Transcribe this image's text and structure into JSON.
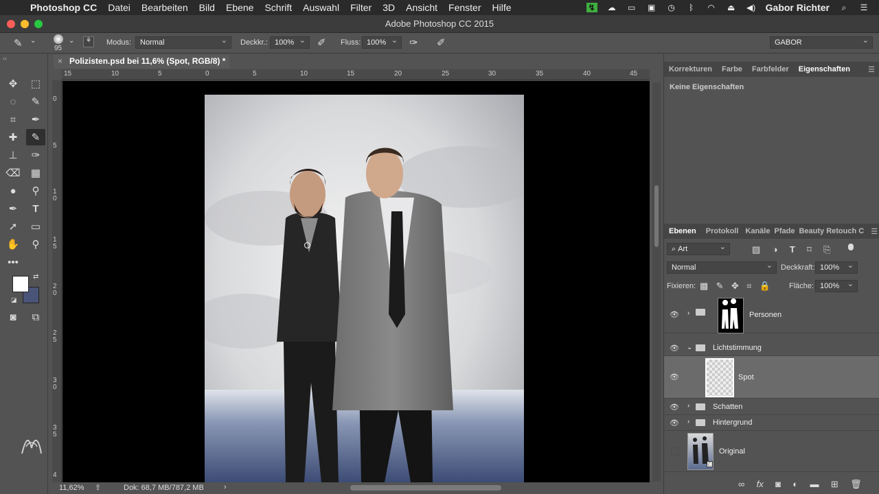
{
  "menubar": {
    "apple": "",
    "app": "Photoshop CC",
    "items": [
      "Datei",
      "Bearbeiten",
      "Bild",
      "Ebene",
      "Schrift",
      "Auswahl",
      "Filter",
      "3D",
      "Ansicht",
      "Fenster",
      "Hilfe"
    ],
    "user": "Gabor Richter"
  },
  "window": {
    "title": "Adobe Photoshop CC 2015"
  },
  "options": {
    "brush_size": "95",
    "mode_label": "Modus:",
    "mode_value": "Normal",
    "opacity_label": "Deckkr.:",
    "opacity_value": "100%",
    "flow_label": "Fluss:",
    "flow_value": "100%",
    "workspace": "GABOR"
  },
  "document": {
    "tab": "Polizisten.psd bei 11,6% (Spot, RGB/8) *",
    "close": "×"
  },
  "ruler": {
    "h_ticks": [
      "15",
      "10",
      "5",
      "0",
      "5",
      "10",
      "15",
      "20",
      "25",
      "30",
      "35",
      "40",
      "45"
    ],
    "v_ticks": [
      "0",
      "5",
      "1 0",
      "1 5",
      "2 0",
      "2 5",
      "3 0",
      "3 5",
      "4"
    ]
  },
  "status": {
    "zoom": "11,62%",
    "doc": "Dok: 68,7 MB/787,2 MB"
  },
  "properties_panel": {
    "tabs": [
      "Korrekturen",
      "Farbe",
      "Farbfelder",
      "Eigenschaften"
    ],
    "active_tab": "Eigenschaften",
    "empty_text": "Keine Eigenschaften"
  },
  "layers_panel": {
    "tabs": [
      "Ebenen",
      "Protokoll",
      "Kanäle",
      "Pfade",
      "Beauty Retouch C"
    ],
    "active_tab": "Ebenen",
    "filter_label": "Art",
    "blend_mode": "Normal",
    "opacity_label": "Deckkraft:",
    "opacity_value": "100%",
    "lock_label": "Fixieren:",
    "fill_label": "Fläche:",
    "fill_value": "100%",
    "layers": [
      {
        "name": "Personen",
        "type": "group-with-mask",
        "visible": true
      },
      {
        "name": "Lichtstimmung",
        "type": "group-open",
        "visible": true
      },
      {
        "name": "Spot",
        "type": "layer",
        "visible": true,
        "selected": true
      },
      {
        "name": "Schatten",
        "type": "group",
        "visible": true
      },
      {
        "name": "Hintergrund",
        "type": "group",
        "visible": true
      },
      {
        "name": "Original",
        "type": "smart-object",
        "visible": false
      }
    ]
  },
  "colors": {
    "foreground": "#ffffff",
    "background": "#4a5478",
    "selected_layer": "#6b6b6b"
  }
}
